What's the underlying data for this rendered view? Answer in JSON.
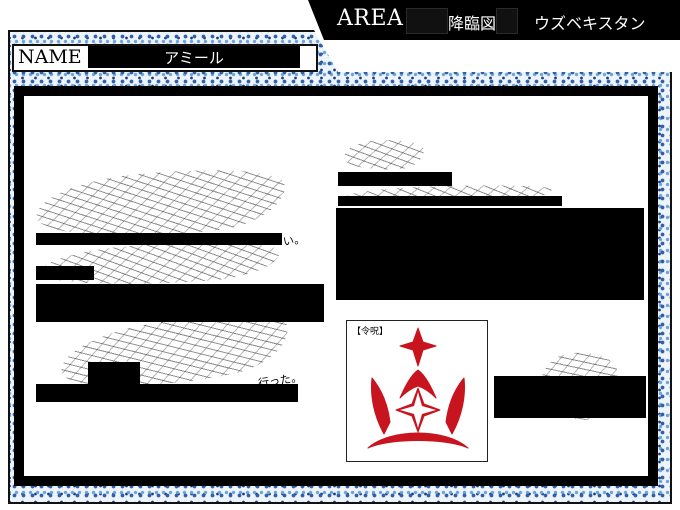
{
  "area": {
    "label": "AREA",
    "place": "降臨図",
    "country": "ウズベキスタン"
  },
  "name": {
    "label": "NAME",
    "value": "アミール"
  },
  "notes": {
    "text_left_1": "い。",
    "text_left_2": "行った。"
  },
  "seal": {
    "label": "【令呪】",
    "color": "#c8141e"
  },
  "colors": {
    "frame_pattern": "#2f5fa8",
    "redaction": "#000000",
    "seal": "#c8141e"
  }
}
